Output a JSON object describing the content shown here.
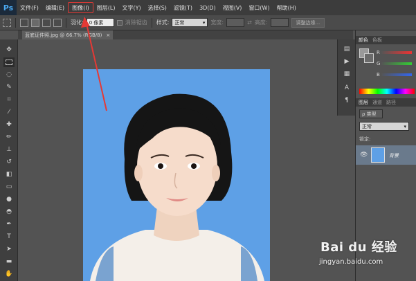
{
  "app": {
    "logo_text": "Ps"
  },
  "menu": [
    {
      "label": "文件(F)"
    },
    {
      "label": "编辑(E)"
    },
    {
      "label": "图像(I)",
      "highlighted": true
    },
    {
      "label": "图层(L)"
    },
    {
      "label": "文字(Y)"
    },
    {
      "label": "选择(S)"
    },
    {
      "label": "滤镜(T)"
    },
    {
      "label": "3D(D)"
    },
    {
      "label": "视图(V)"
    },
    {
      "label": "窗口(W)"
    },
    {
      "label": "帮助(H)"
    }
  ],
  "options_bar": {
    "feather_label": "羽化:",
    "feather_value": "0 像素",
    "antialias_label": "消除锯齿",
    "style_label": "样式:",
    "style_value": "正常",
    "width_label": "宽度:",
    "height_label": "高度:",
    "refine_button": "调整边缘..."
  },
  "document": {
    "tab_label": "蓝底证件照.jpg @ 66.7% (RGB/8)",
    "close_glyph": "×"
  },
  "panels": {
    "color_tab": "颜色",
    "swatch_tab": "色板",
    "channels": [
      "R",
      "G",
      "B"
    ],
    "layers_tab": "图层",
    "channels_tab": "通道",
    "paths_tab": "路径",
    "filter_kind": "ρ 类型",
    "blend_mode": "正常",
    "lock_label": "锁定:",
    "layer_name": "背景"
  },
  "watermark": {
    "logo_text": "Bai du 经验",
    "url": "jingyan.baidu.com"
  },
  "colors": {
    "photo_background": "#5ea0e6",
    "annotation_red": "#e53935"
  }
}
